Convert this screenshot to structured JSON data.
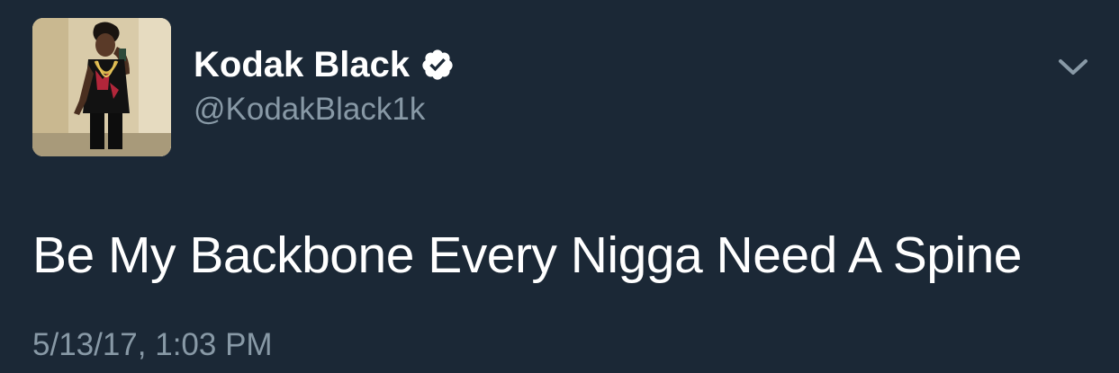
{
  "tweet": {
    "author": {
      "display_name": "Kodak Black",
      "handle": "@KodakBlack1k",
      "verified": true
    },
    "text": "Be My Backbone Every Nigga Need A Spine",
    "timestamp": "5/13/17, 1:03 PM"
  },
  "colors": {
    "background": "#1b2836",
    "primary_text": "#ffffff",
    "secondary_text": "#8899a6",
    "chevron": "#8899a6"
  },
  "icons": {
    "verified": "verified-badge-icon",
    "menu": "chevron-down-icon"
  }
}
